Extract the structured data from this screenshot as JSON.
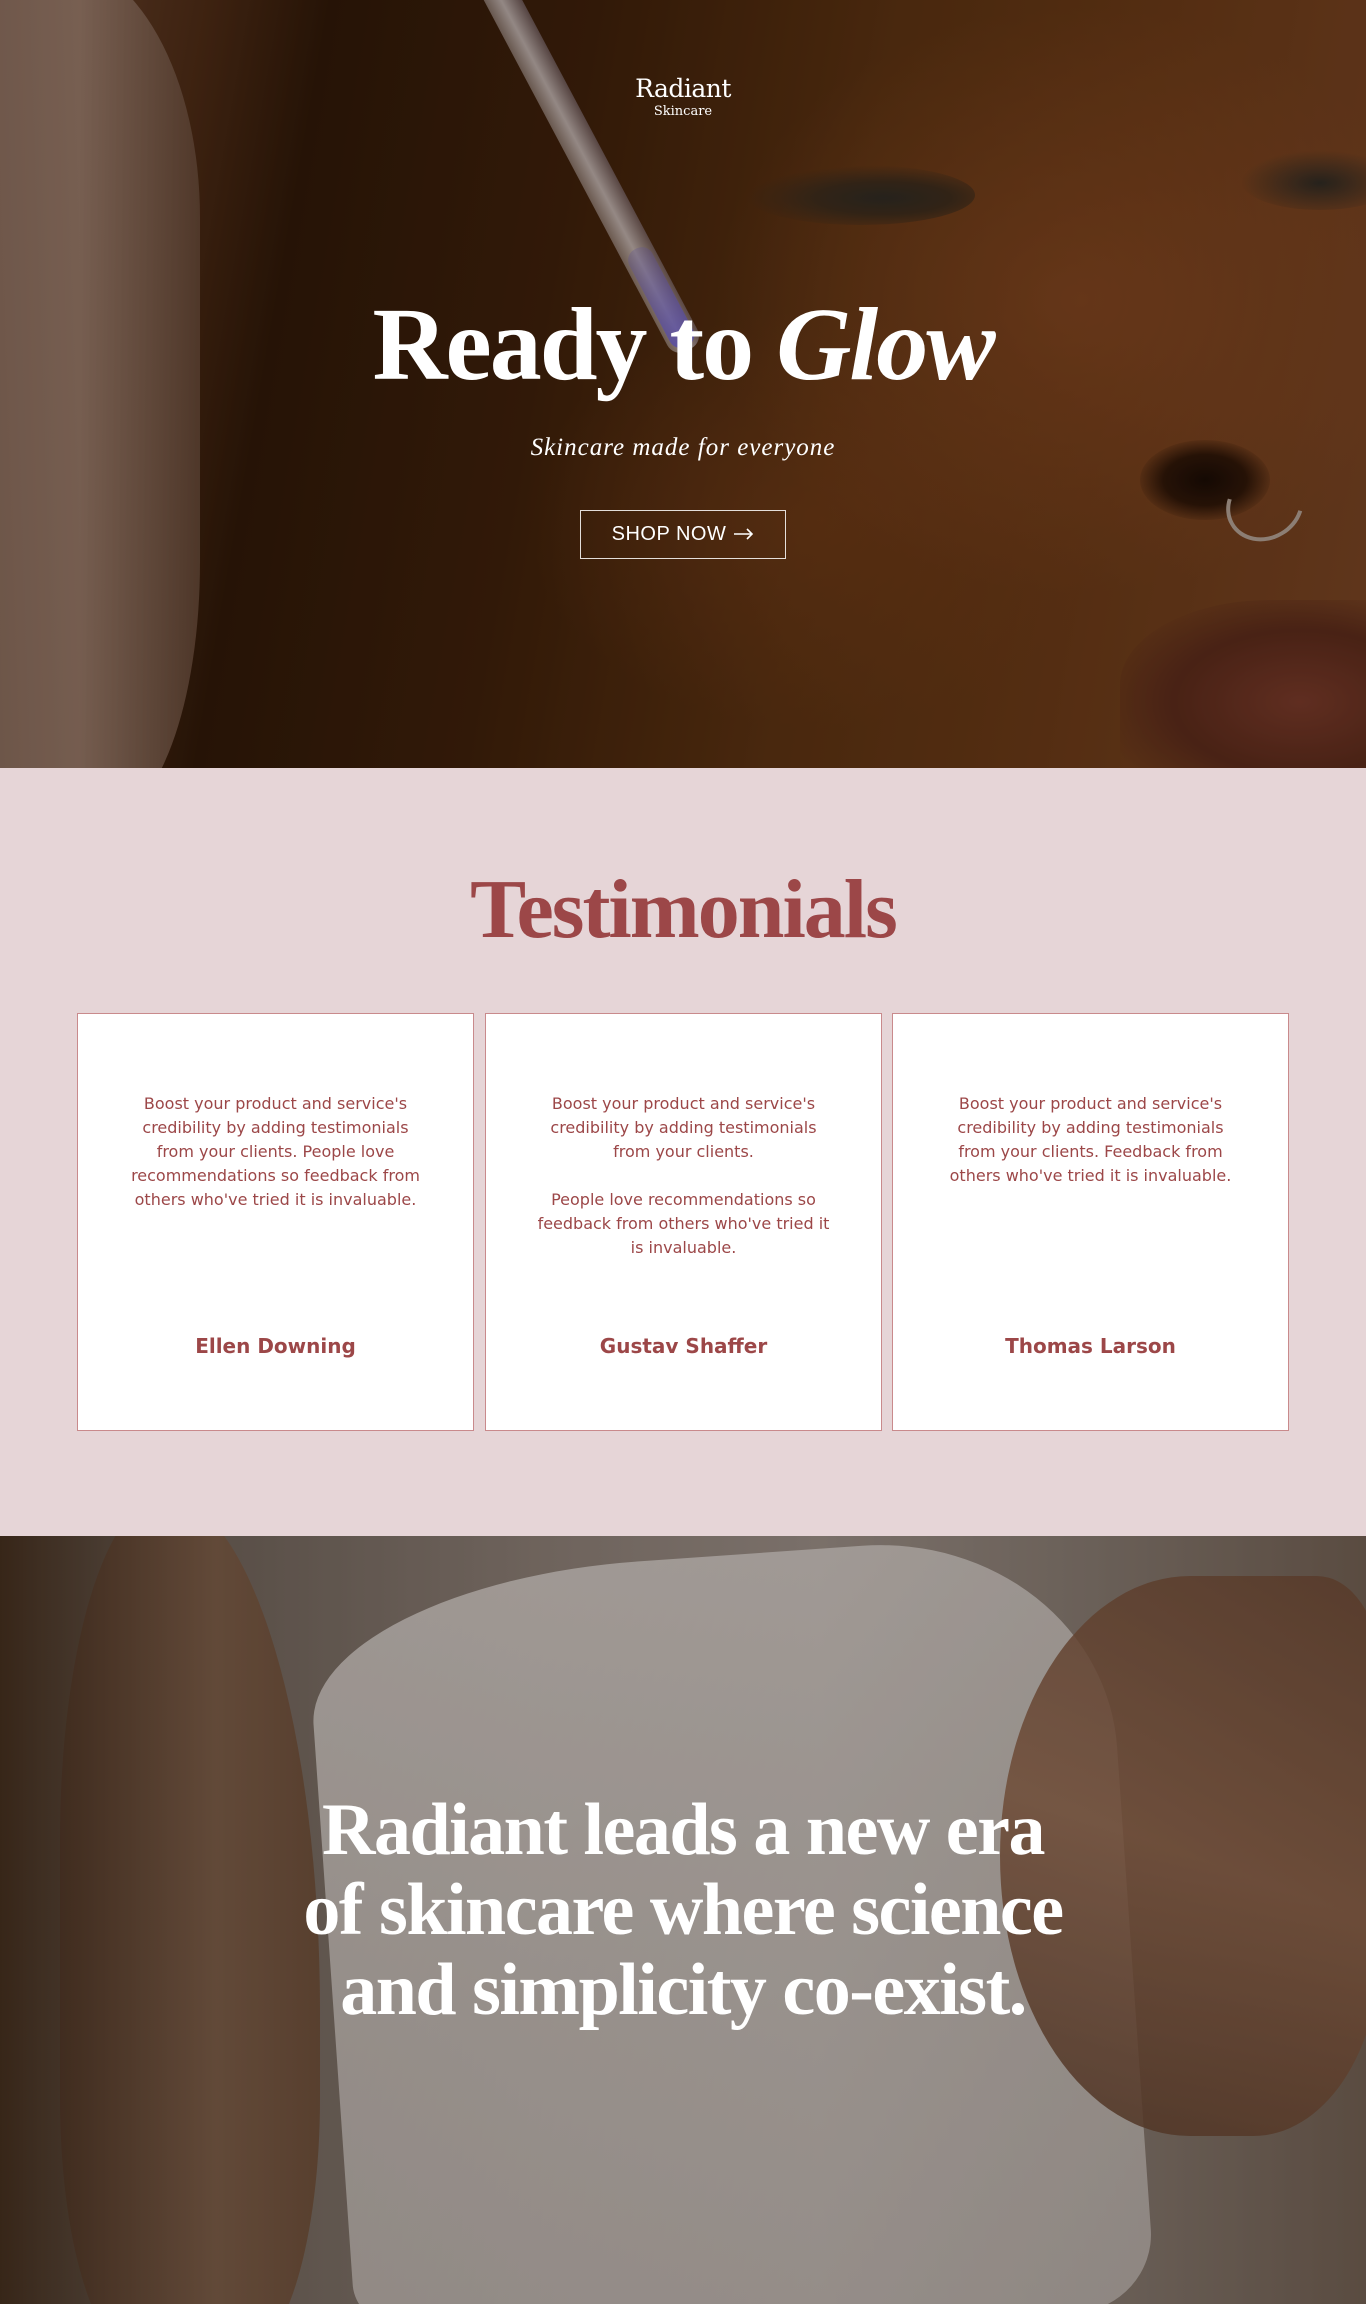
{
  "brand": {
    "name": "Radiant",
    "tagline": "Skincare"
  },
  "hero": {
    "title_plain": "Ready to ",
    "title_emphasis": "Glow",
    "subtitle": "Skincare made for everyone",
    "cta_label": "SHOP NOW",
    "cta_icon": "arrow-right-icon"
  },
  "testimonials": {
    "heading": "Testimonials",
    "cards": [
      {
        "paragraphs": [
          "Boost your product and service's credibility by adding testimonials from your clients. People love recommendations so feedback from others who've tried it is invaluable."
        ],
        "author": "Ellen Downing"
      },
      {
        "paragraphs": [
          "Boost your product and service's credibility by adding testimonials from your clients.",
          "People love recommendations so feedback from others who've tried it is invaluable."
        ],
        "author": "Gustav Shaffer"
      },
      {
        "paragraphs": [
          "Boost your product and service's credibility by adding testimonials from your clients. Feedback from others who've tried it is invaluable."
        ],
        "author": "Thomas Larson"
      }
    ]
  },
  "statement": {
    "lines": [
      "Radiant leads a new era",
      "of skincare where science",
      "and simplicity co-exist."
    ]
  },
  "colors": {
    "accent": "#9c4748",
    "section_bg": "#e6d5d7",
    "card_border": "#c98a8c"
  }
}
